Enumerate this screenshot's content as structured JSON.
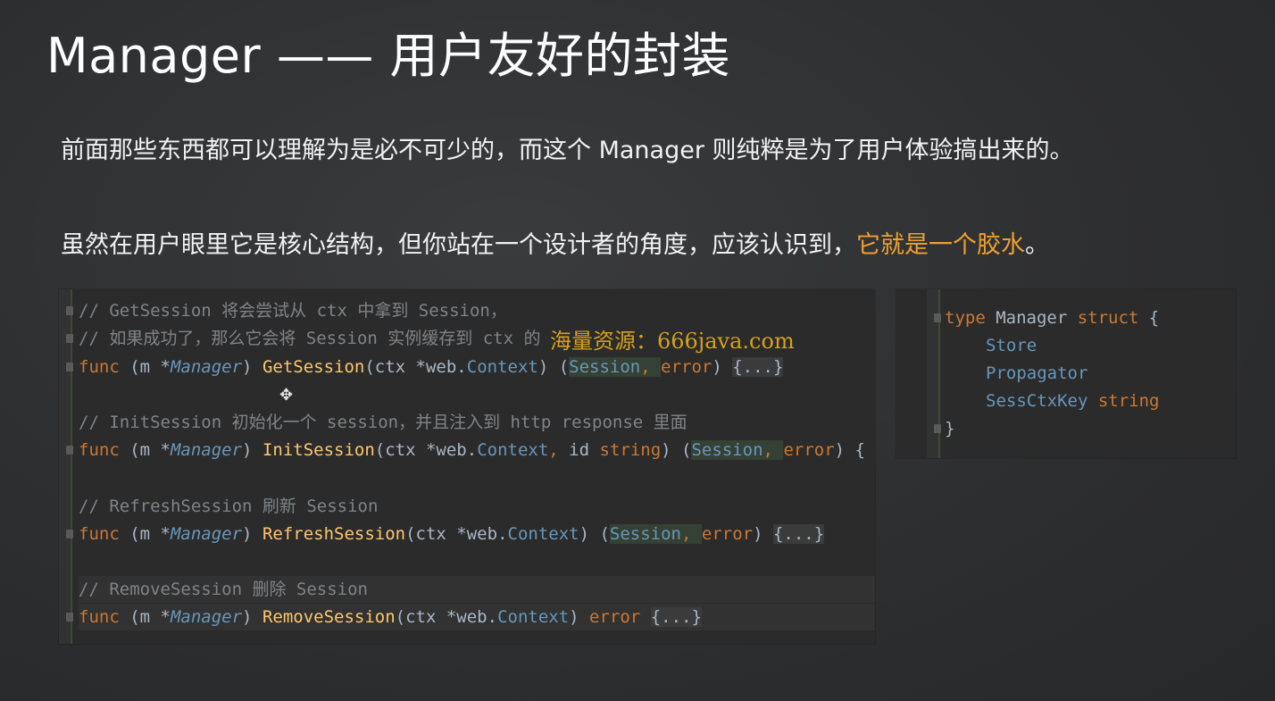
{
  "title": "Manager —— 用户友好的封装",
  "paragraph1": "前面那些东西都可以理解为是必不可少的，而这个 Manager 则纯粹是为了用户体验搞出来的。",
  "paragraph2": {
    "prefix": "虽然在用户眼里它是核心结构，但你站在一个设计者的角度，应该认识到，",
    "highlight": "它就是一个胶水",
    "suffix": "。"
  },
  "colors": {
    "highlight": "#f0a030",
    "keyword": "#cc7832",
    "function": "#ffc66d",
    "type": "#6897bb",
    "comment": "#7f8487",
    "watermark": "#d4a21a"
  },
  "watermark": "海量资源：666java.com",
  "cursor_icon": "move-cursor-icon",
  "code_left": {
    "l1_comment": "// GetSession 将会尝试从 ctx 中拿到 Session，",
    "l2_comment": "// 如果成功了，那么它会将 Session 实例缓存到 ctx 的",
    "l3": {
      "kw": "func",
      "recv_open": " (m *",
      "recv_type": "Manager",
      "recv_close": ") ",
      "name": "GetSession",
      "params_open": "(ctx *",
      "pkg": "web",
      "dot": ".",
      "ctype": "Context",
      "params_close": ") (",
      "ret1": "Session",
      "comma": ", ",
      "ret2": "error",
      "ret_close": ") ",
      "body": "{...}"
    },
    "l4_comment": "// InitSession 初始化一个 session，并且注入到 http response 里面",
    "l5": {
      "kw": "func",
      "recv_open": " (m *",
      "recv_type": "Manager",
      "recv_close": ") ",
      "name": "InitSession",
      "params_open": "(ctx *",
      "pkg": "web",
      "dot": ".",
      "ctype": "Context",
      "comma1": ", ",
      "p2": "id ",
      "p2type": "string",
      "params_close": ") (",
      "ret1": "Session",
      "comma": ", ",
      "ret2": "error",
      "ret_close": ") {"
    },
    "l6_comment": "// RefreshSession 刷新 Session",
    "l7": {
      "kw": "func",
      "recv_open": " (m *",
      "recv_type": "Manager",
      "recv_close": ") ",
      "name": "RefreshSession",
      "params_open": "(ctx *",
      "pkg": "web",
      "dot": ".",
      "ctype": "Context",
      "params_close": ") (",
      "ret1": "Session",
      "comma": ", ",
      "ret2": "error",
      "ret_close": ") ",
      "body": "{...}"
    },
    "l8_comment": "// RemoveSession 删除 Session",
    "l9": {
      "kw": "func",
      "recv_open": " (m *",
      "recv_type": "Manager",
      "recv_close": ") ",
      "name": "RemoveSession",
      "params_open": "(ctx *",
      "pkg": "web",
      "dot": ".",
      "ctype": "Context",
      "params_close": ") ",
      "ret": "error",
      "space": " ",
      "body": "{...}"
    }
  },
  "code_right": {
    "l1": {
      "kw1": "type",
      "name": " Manager ",
      "kw2": "struct",
      "brace": " {"
    },
    "l2": "Store",
    "l3": "Propagator",
    "l4": {
      "field": "SessCtxKey ",
      "type": "string"
    },
    "l5": "}"
  }
}
